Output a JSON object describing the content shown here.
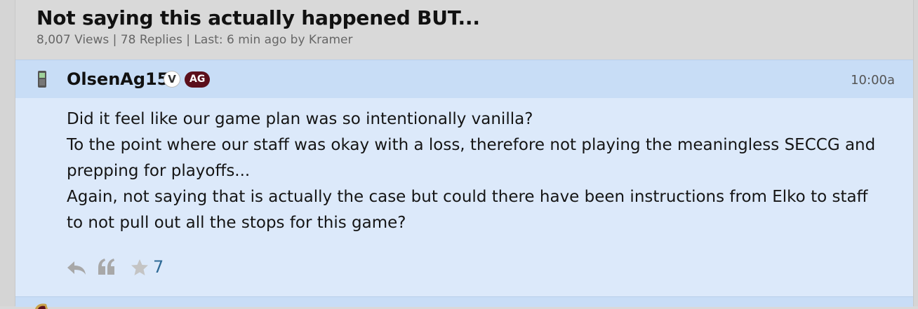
{
  "thread": {
    "title": "Not saying this actually happened BUT...",
    "meta": "8,007 Views | 78 Replies | Last: 6 min ago by Kramer"
  },
  "post": {
    "device_icon": "mobile-phone-icon",
    "username": "OlsenAg15",
    "badge_v": "V",
    "badge_ag": "AG",
    "time": "10:00a",
    "body_lines": [
      "Did it feel like our game plan was so intentionally vanilla?",
      "To the point where our staff was okay with a loss, therefore not playing the meaningless SECCG and prepping for playoffs...",
      "Again, not saying that is actually the case but could there have been instructions from Elko to staff to not pull out all the stops for this game?"
    ],
    "actions": {
      "reply_icon": "reply-icon",
      "quote_icon": "quote-icon",
      "star_icon": "star-icon",
      "star_count": "7"
    }
  },
  "colors": {
    "page_bg": "#d9d9d9",
    "post_bg": "#dce9fa",
    "post_header_bg": "#c8ddf6",
    "badge_ag_bg": "#5b0f1b",
    "star_count": "#2f6a96"
  }
}
